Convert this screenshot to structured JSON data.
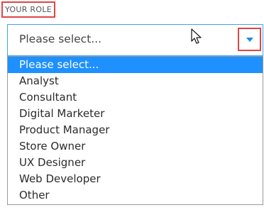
{
  "form": {
    "label": "YOUR ROLE",
    "select": {
      "selected_value": "Please select...",
      "caret_icon": "caret-down-icon"
    },
    "dropdown": {
      "options": [
        "Please select...",
        "Analyst",
        "Consultant",
        "Digital Marketer",
        "Product Manager",
        "Store Owner",
        "UX Designer",
        "Web Developer",
        "Other"
      ],
      "highlighted_index": 0
    }
  },
  "colors": {
    "highlight": "#1e90ff",
    "focus_border": "#42a5e6",
    "annotation_border": "#e04545",
    "caret": "#1e88e5"
  },
  "icons": {
    "cursor": "mouse-pointer-icon"
  }
}
